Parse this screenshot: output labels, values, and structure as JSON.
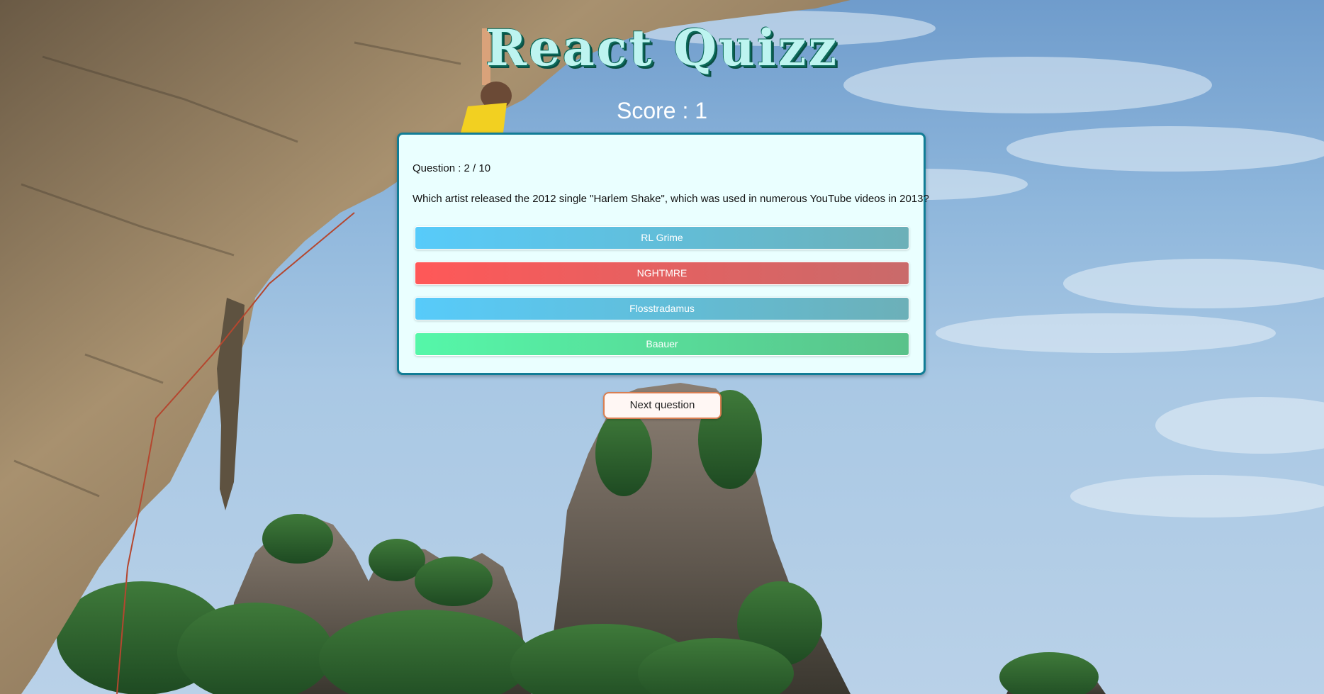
{
  "app": {
    "title": "React Quizz",
    "score_text": "Score : 1"
  },
  "quiz": {
    "question_number": "Question : 2 / 10",
    "question_text": "Which artist released the 2012 single \"Harlem Shake\", which was used in numerous YouTube videos in 2013?",
    "answers": [
      {
        "label": "RL Grime",
        "state": "neutral"
      },
      {
        "label": "NGHTMRE",
        "state": "wrong"
      },
      {
        "label": "Flosstradamus",
        "state": "neutral"
      },
      {
        "label": "Baauer",
        "state": "correct"
      }
    ]
  },
  "actions": {
    "next_label": "Next question"
  },
  "colors": {
    "card_border": "#117d96",
    "card_bg": "#eaffff",
    "neutral_answer": "#57cbfa",
    "wrong_answer": "#ff5858",
    "correct_answer": "#55f7a9",
    "next_border": "#d97f52",
    "title_fill": "#bdf4f0"
  }
}
